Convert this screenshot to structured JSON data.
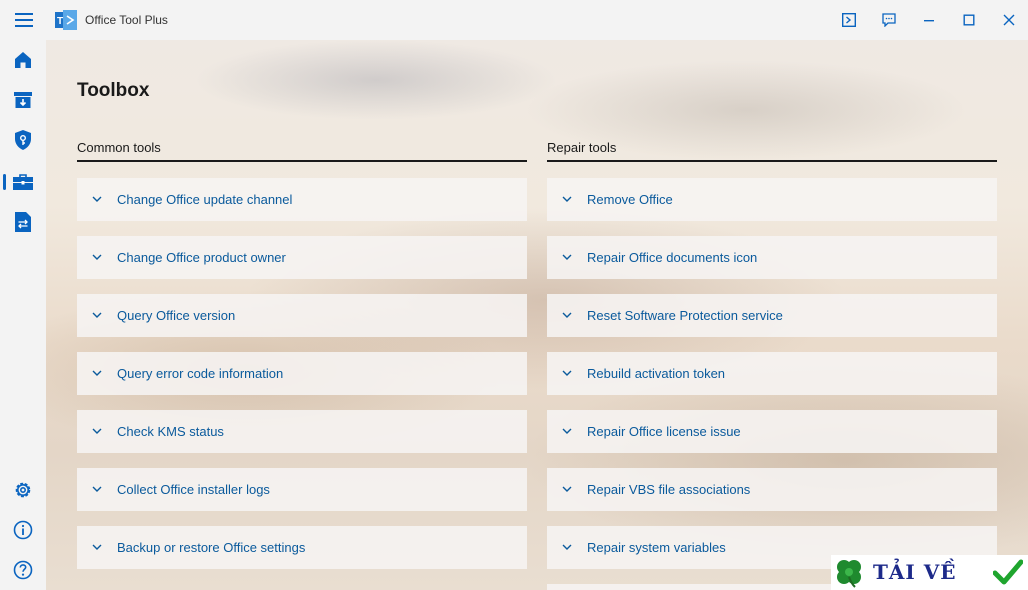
{
  "app": {
    "title": "Office Tool Plus"
  },
  "icons": {
    "menu": "hamburger-icon",
    "logo": "office-tool-plus-logo",
    "window": [
      "console-icon",
      "feedback-icon",
      "minimize-icon",
      "maximize-icon",
      "close-icon"
    ],
    "nav_top": [
      "home-icon",
      "deploy-icon",
      "activation-icon",
      "toolbox-icon",
      "convert-icon"
    ],
    "nav_bottom": [
      "settings-icon",
      "about-icon",
      "help-icon"
    ],
    "expand": "chevron-down-icon"
  },
  "colors": {
    "accent": "#0a64c0",
    "link": "#0a5a9c",
    "chrome": "#f3f3f3",
    "card": "#f6f4f2"
  },
  "nav": {
    "active": "toolbox"
  },
  "page": {
    "title": "Toolbox"
  },
  "sections": {
    "common": {
      "header": "Common tools",
      "items": [
        "Change Office update channel",
        "Change Office product owner",
        "Query Office version",
        "Query error code information",
        "Check KMS status",
        "Collect Office installer logs",
        "Backup or restore Office settings"
      ]
    },
    "repair": {
      "header": "Repair tools",
      "items": [
        "Remove Office",
        "Repair Office documents icon",
        "Reset Software Protection service",
        "Rebuild activation token",
        "Repair Office license issue",
        "Repair VBS file associations",
        "Repair system variables"
      ]
    }
  },
  "watermark": {
    "text": "TẢI VỀ"
  }
}
